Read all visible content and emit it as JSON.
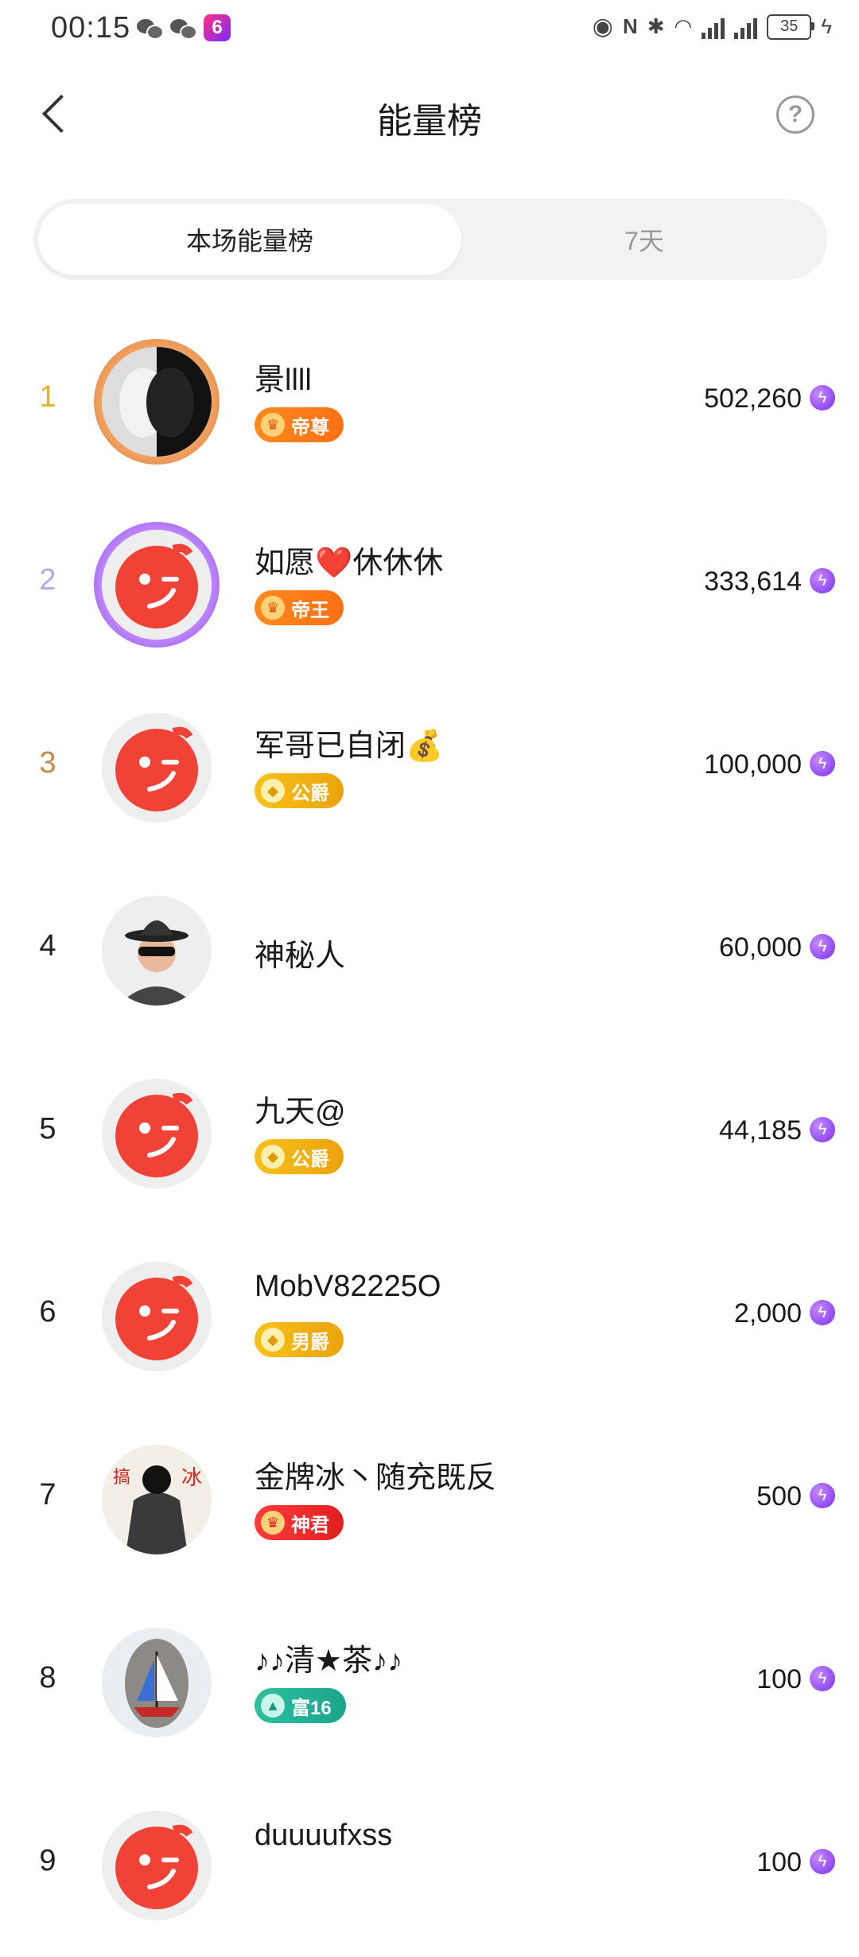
{
  "status_bar": {
    "time": "00:15",
    "app_badge": "6",
    "battery": "35"
  },
  "header": {
    "title": "能量榜"
  },
  "tabs": [
    {
      "label": "本场能量榜",
      "active": true
    },
    {
      "label": "7天",
      "active": false
    }
  ],
  "rows": [
    {
      "rank": "1",
      "name": "景llll",
      "badge": "帝尊",
      "energy": "502,260"
    },
    {
      "rank": "2",
      "name": "如愿❤️休休休",
      "badge": "帝王",
      "energy": "333,614"
    },
    {
      "rank": "3",
      "name": "军哥已自闭💰",
      "badge": "公爵",
      "energy": "100,000"
    },
    {
      "rank": "4",
      "name": "神秘人",
      "badge": "",
      "energy": "60,000"
    },
    {
      "rank": "5",
      "name": "九天@",
      "badge": "公爵",
      "energy": "44,185"
    },
    {
      "rank": "6",
      "name": "MobV82225O",
      "badge": "男爵",
      "energy": "2,000"
    },
    {
      "rank": "7",
      "name": "金牌冰丶随充既反",
      "badge": "神君",
      "energy": "500"
    },
    {
      "rank": "8",
      "name": "♪♪清★茶♪♪",
      "badge": "富16",
      "energy": "100"
    },
    {
      "rank": "9",
      "name": "duuuufxss",
      "badge": "",
      "energy": "100"
    }
  ],
  "colors": {
    "rank1": "#e8b21e",
    "rank2": "#b7a6e8",
    "rank3": "#c9894a",
    "energy_icon": "#8a3cf2"
  }
}
